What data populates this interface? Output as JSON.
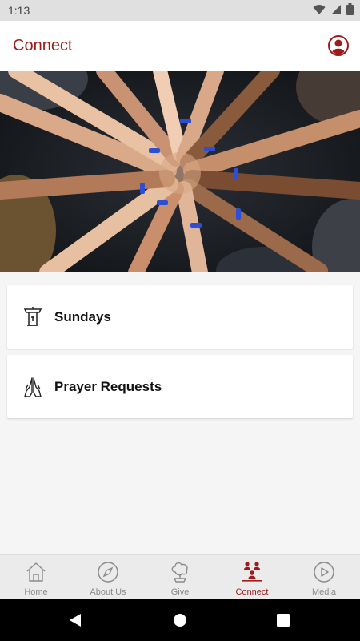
{
  "status": {
    "time": "1:13",
    "icons": [
      "wifi-icon",
      "signal-icon",
      "battery-icon"
    ]
  },
  "app": {
    "title": "Connect",
    "accent": "#9e1b1b"
  },
  "hero": {
    "image": "group-hands-photo"
  },
  "cards": [
    {
      "label": "Sundays",
      "icon": "pulpit-icon"
    },
    {
      "label": "Prayer Requests",
      "icon": "praying-hands-icon"
    }
  ],
  "nav": {
    "items": [
      {
        "label": "Home",
        "icon": "home-icon",
        "active": false
      },
      {
        "label": "About Us",
        "icon": "compass-icon",
        "active": false
      },
      {
        "label": "Give",
        "icon": "give-icon",
        "active": false
      },
      {
        "label": "Connect",
        "icon": "people-icon",
        "active": true
      },
      {
        "label": "Media",
        "icon": "play-icon",
        "active": false
      }
    ]
  },
  "system_nav": {
    "buttons": [
      "back-button",
      "home-button",
      "recents-button"
    ]
  }
}
